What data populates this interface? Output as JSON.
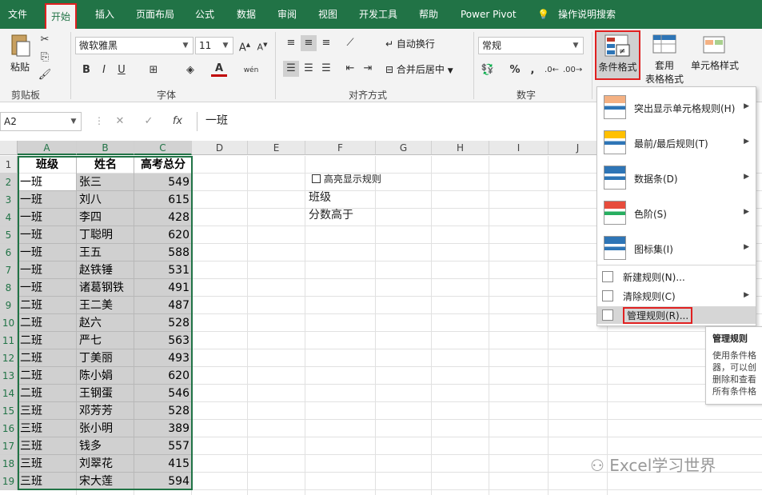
{
  "tabs": [
    "文件",
    "开始",
    "插入",
    "页面布局",
    "公式",
    "数据",
    "审阅",
    "视图",
    "开发工具",
    "帮助",
    "Power Pivot",
    "操作说明搜索"
  ],
  "active_tab": "开始",
  "ribbon": {
    "paste_label": "粘贴",
    "clipboard_label": "剪贴板",
    "font_name": "微软雅黑",
    "font_size": "11",
    "font_group_label": "字体",
    "bold": "B",
    "italic": "I",
    "underline": "U",
    "phonetic": "wén",
    "font_color_glyph": "A",
    "wrap_text": "自动换行",
    "merge_center": "合并后居中",
    "align_group_label": "对齐方式",
    "number_format": "常规",
    "number_group_label": "数字",
    "percent": "%",
    "comma": ",",
    "conditional_format": "条件格式",
    "table_format_1": "套用",
    "table_format_2": "表格格式",
    "cell_style": "单元格样式"
  },
  "formula_bar": {
    "name_box": "A2",
    "fx": "fx",
    "content": "一班"
  },
  "columns": [
    "A",
    "B",
    "C",
    "D",
    "E",
    "F",
    "G",
    "H",
    "I",
    "J"
  ],
  "headers": [
    "班级",
    "姓名",
    "高考总分"
  ],
  "rows": [
    [
      "一班",
      "张三",
      "549"
    ],
    [
      "一班",
      "刘八",
      "615"
    ],
    [
      "一班",
      "李四",
      "428"
    ],
    [
      "一班",
      "丁聪明",
      "620"
    ],
    [
      "一班",
      "王五",
      "588"
    ],
    [
      "一班",
      "赵铁锤",
      "531"
    ],
    [
      "一班",
      "诸葛钢铁",
      "491"
    ],
    [
      "二班",
      "王二美",
      "487"
    ],
    [
      "二班",
      "赵六",
      "528"
    ],
    [
      "二班",
      "严七",
      "563"
    ],
    [
      "二班",
      "丁美丽",
      "493"
    ],
    [
      "二班",
      "陈小娟",
      "620"
    ],
    [
      "二班",
      "王钢蛋",
      "546"
    ],
    [
      "三班",
      "邓芳芳",
      "528"
    ],
    [
      "三班",
      "张小明",
      "389"
    ],
    [
      "三班",
      "钱多",
      "557"
    ],
    [
      "三班",
      "刘翠花",
      "415"
    ],
    [
      "三班",
      "宋大莲",
      "594"
    ]
  ],
  "side_panel": {
    "checkbox_label": "高亮显示规则",
    "line1": "班级",
    "line2": "分数高于"
  },
  "menu": {
    "items": [
      {
        "label": "突出显示单元格规则(H)",
        "submenu": true
      },
      {
        "label": "最前/最后规则(T)",
        "submenu": true
      },
      {
        "label": "数据条(D)",
        "submenu": true
      },
      {
        "label": "色阶(S)",
        "submenu": true
      },
      {
        "label": "图标集(I)",
        "submenu": true
      }
    ],
    "small_items": [
      {
        "label": "新建规则(N)...",
        "submenu": false
      },
      {
        "label": "清除规则(C)",
        "submenu": true
      },
      {
        "label": "管理规则(R)...",
        "submenu": false
      }
    ]
  },
  "tooltip": {
    "title": "管理规则",
    "body": "使用条件格 器，可以创 删除和查看 所有条件格"
  },
  "watermark": "Excel学习世界",
  "colors": {
    "excel_green": "#217346",
    "highlight_red": "#e02020",
    "selection_fill": "#d0d0d0"
  }
}
